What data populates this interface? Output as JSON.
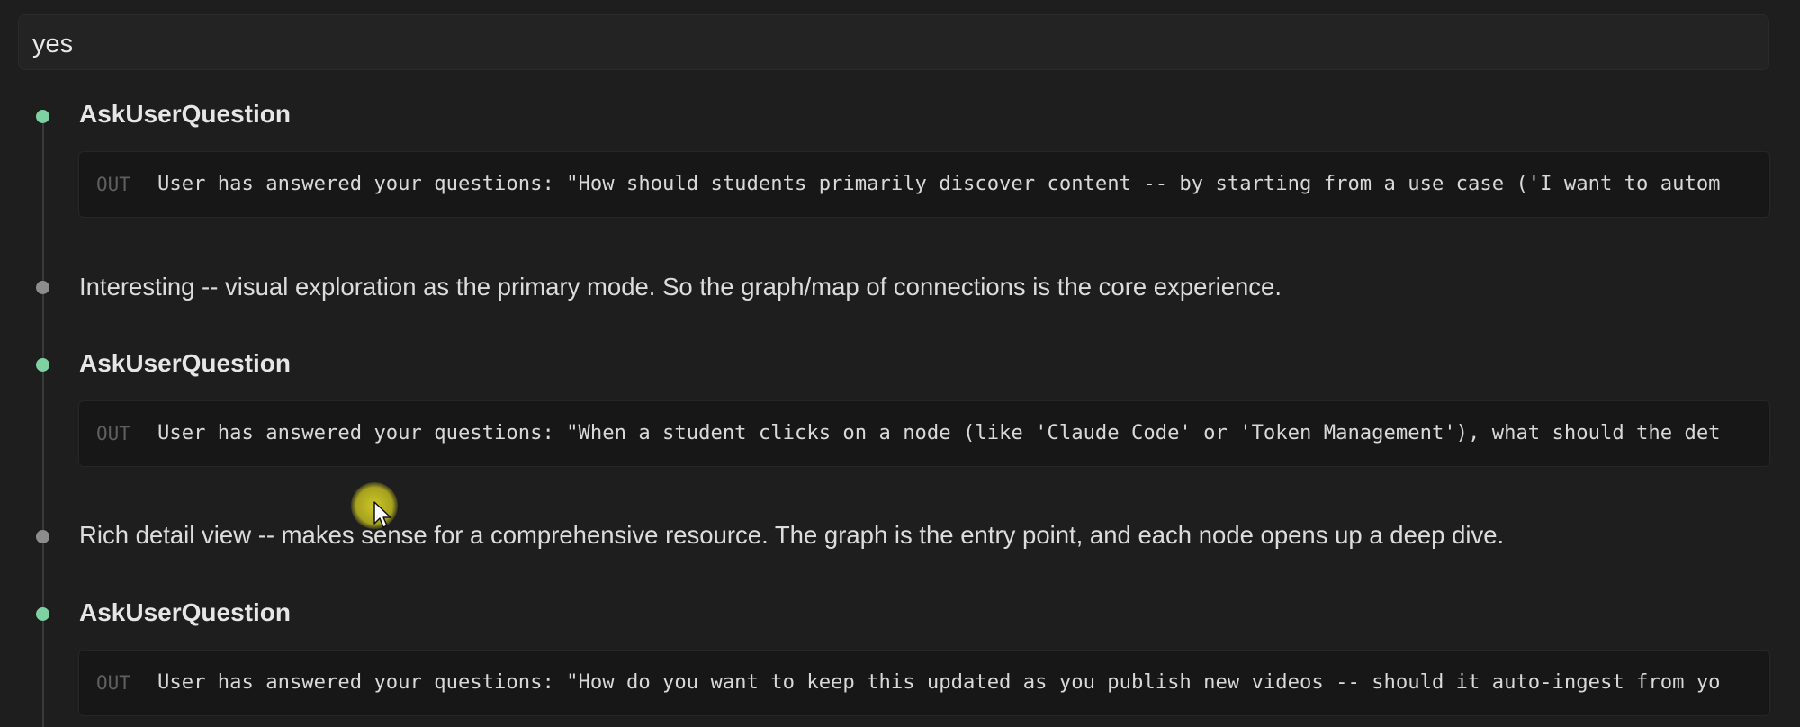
{
  "user_message": {
    "text": "yes"
  },
  "blocks": [
    {
      "kind": "tool",
      "title": "AskUserQuestion",
      "out_label": "OUT",
      "out_text": "User has answered your questions: \"How should students primarily discover content -- by starting from a use case ('I want to autom"
    },
    {
      "kind": "text",
      "text": "Interesting -- visual exploration as the primary mode. So the graph/map of connections is the core experience."
    },
    {
      "kind": "tool",
      "title": "AskUserQuestion",
      "out_label": "OUT",
      "out_text": "User has answered your questions: \"When a student clicks on a node (like 'Claude Code' or 'Token Management'), what should the det"
    },
    {
      "kind": "text",
      "text": "Rich detail view -- makes sense for a comprehensive resource. The graph is the entry point, and each node opens up a deep dive."
    },
    {
      "kind": "tool",
      "title": "AskUserQuestion",
      "out_label": "OUT",
      "out_text": "User has answered your questions: \"How do you want to keep this updated as you publish new videos -- should it auto-ingest from yo"
    }
  ],
  "colors": {
    "tool_dot": "#7fd1a2",
    "text_dot": "#8d8d8d",
    "background": "#1e1e1e",
    "cursor_highlight": "#d6d028"
  },
  "icons": {
    "cursor": "mouse-pointer-icon"
  }
}
